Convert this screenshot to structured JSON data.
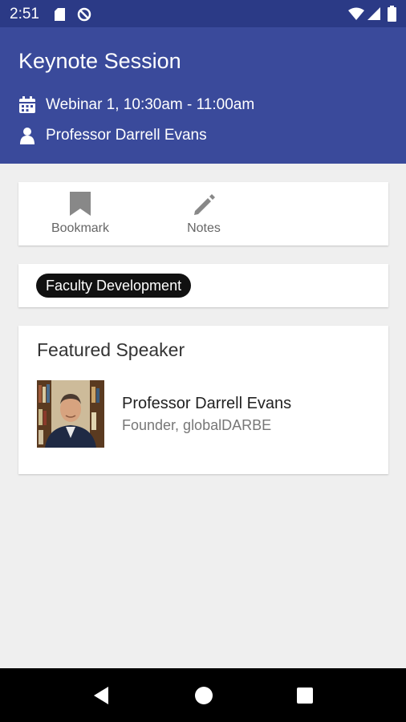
{
  "status_bar": {
    "time": "2:51",
    "icons": [
      "sd-card-icon",
      "vpn-icon",
      "wifi-icon",
      "signal-icon",
      "battery-icon"
    ]
  },
  "header": {
    "title": "Keynote Session",
    "schedule_icon": "calendar-icon",
    "schedule": "Webinar 1, 10:30am - 11:00am",
    "speaker_icon": "person-icon",
    "speaker": "Professor Darrell Evans"
  },
  "actions": {
    "bookmark": {
      "icon": "bookmark-icon",
      "label": "Bookmark"
    },
    "notes": {
      "icon": "pencil-icon",
      "label": "Notes"
    }
  },
  "tags": [
    "Faculty Development"
  ],
  "featured": {
    "heading": "Featured Speaker",
    "speaker_name": "Professor Darrell Evans",
    "speaker_role": "Founder, globalDARBE"
  },
  "nav": {
    "icons": [
      "back-icon",
      "home-icon",
      "recents-icon"
    ]
  },
  "colors": {
    "status_bar": "#2b3a86",
    "header": "#3a4a9b",
    "background": "#efefef",
    "tag_chip": "#111111",
    "icon_gray": "#888888"
  }
}
